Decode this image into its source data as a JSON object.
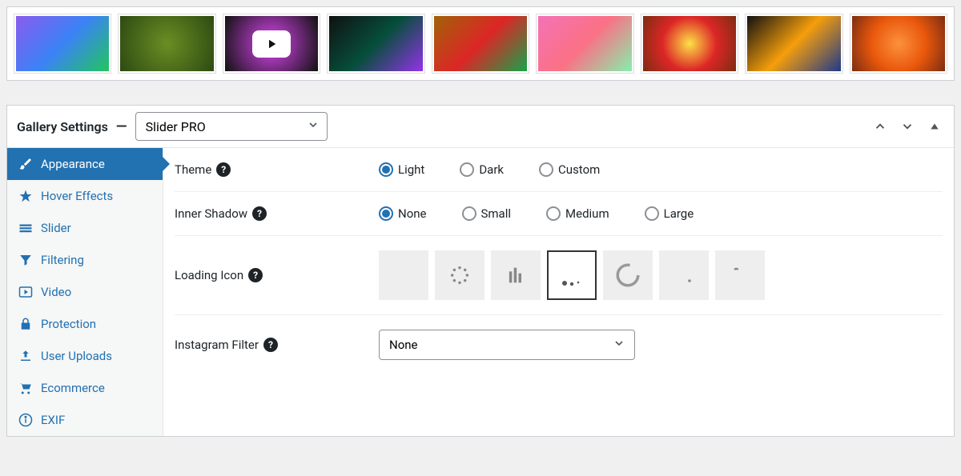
{
  "gallery": {
    "thumbnails": [
      {
        "gradient": "linear-gradient(135deg,#8a5cf0,#3b82f6,#22c55e)",
        "video": false
      },
      {
        "gradient": "radial-gradient(circle at 50% 50%, #6b8e23, #2d4a12)",
        "video": false
      },
      {
        "gradient": "radial-gradient(circle at 50% 50%, #d946ef, #111)",
        "video": true
      },
      {
        "gradient": "linear-gradient(135deg,#111,#064e3b,#9333ea)",
        "video": false
      },
      {
        "gradient": "linear-gradient(135deg,#a16207,#dc2626,#16a34a)",
        "video": false
      },
      {
        "gradient": "linear-gradient(135deg,#f472b6,#fb7185,#86efac)",
        "video": false
      },
      {
        "gradient": "radial-gradient(circle at 50% 50%, #fde047,#dc2626,#7c2d12)",
        "video": false
      },
      {
        "gradient": "linear-gradient(135deg,#111,#f59e0b,#1e3a8a)",
        "video": false
      },
      {
        "gradient": "radial-gradient(circle at 50% 50%, #fb923c,#ea580c,#7c2d12)",
        "video": false
      }
    ]
  },
  "panel": {
    "title": "Gallery Settings",
    "dash": "—",
    "preset_selected": "Slider PRO"
  },
  "sidebar": {
    "items": [
      {
        "key": "appearance",
        "label": "Appearance",
        "icon": "brush",
        "active": true
      },
      {
        "key": "hover",
        "label": "Hover Effects",
        "icon": "star",
        "active": false
      },
      {
        "key": "slider",
        "label": "Slider",
        "icon": "slider",
        "active": false
      },
      {
        "key": "filtering",
        "label": "Filtering",
        "icon": "filter",
        "active": false
      },
      {
        "key": "video",
        "label": "Video",
        "icon": "play",
        "active": false
      },
      {
        "key": "protection",
        "label": "Protection",
        "icon": "lock",
        "active": false
      },
      {
        "key": "uploads",
        "label": "User Uploads",
        "icon": "upload",
        "active": false
      },
      {
        "key": "ecommerce",
        "label": "Ecommerce",
        "icon": "cart",
        "active": false
      },
      {
        "key": "exif",
        "label": "EXIF",
        "icon": "info",
        "active": false
      }
    ]
  },
  "settings": {
    "theme": {
      "label": "Theme",
      "options": [
        "Light",
        "Dark",
        "Custom"
      ],
      "selected": "Light"
    },
    "inner_shadow": {
      "label": "Inner Shadow",
      "options": [
        "None",
        "Small",
        "Medium",
        "Large"
      ],
      "selected": "None"
    },
    "loading_icon": {
      "label": "Loading Icon",
      "selected_index": 3,
      "count": 7
    },
    "instagram_filter": {
      "label": "Instagram Filter",
      "selected": "None"
    }
  }
}
